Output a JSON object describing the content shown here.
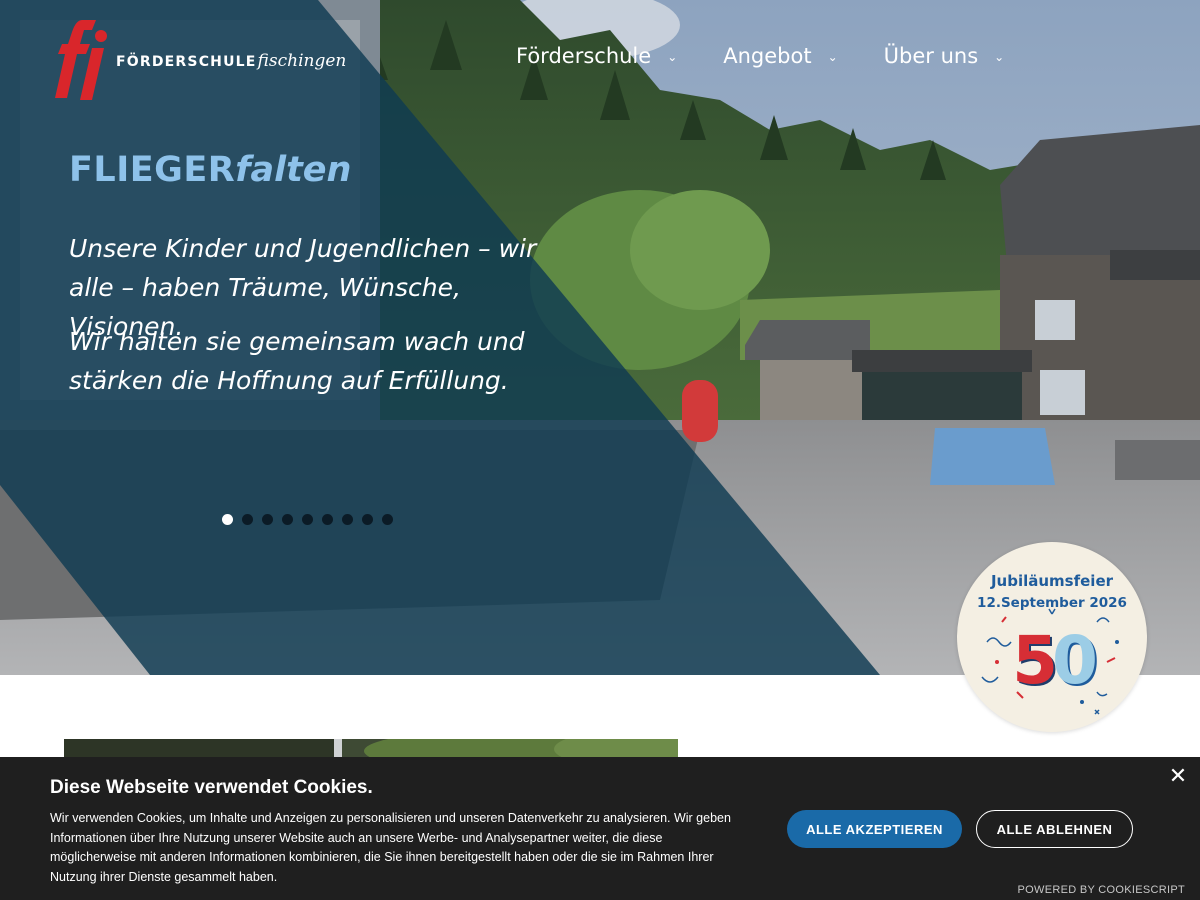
{
  "header": {
    "logo_bold": "FÖRDERSCHULE",
    "logo_italic": "fischingen",
    "nav": [
      {
        "label": "Förderschule",
        "icon": "chevron-down-icon"
      },
      {
        "label": "Angebot",
        "icon": "chevron-down-icon"
      },
      {
        "label": "Über uns",
        "icon": "chevron-down-icon"
      }
    ]
  },
  "slide": {
    "title_bold": "FLIEGER",
    "title_italic": "falten",
    "paragraph_1": "Unsere Kinder und Jugendlichen – wir alle – haben Träume, Wünsche, Visionen.",
    "paragraph_2": "Wir halten sie gemeinsam wach und stärken die Hoffnung auf Erfüllung.",
    "dot_count": 9,
    "active_dot": 1
  },
  "jubilee": {
    "line_1": "Jubiläumsfeier",
    "line_2": "12.September 2026",
    "digit_1": "5",
    "digit_2": "0"
  },
  "cookie": {
    "title": "Diese Webseite verwendet Cookies.",
    "text": "Wir verwenden Cookies, um Inhalte und Anzeigen zu personalisieren und unseren Datenverkehr zu analysieren. Wir geben Informationen über Ihre Nutzung unserer Website auch an unsere Werbe- und Analysepartner weiter, die diese möglicherweise mit anderen Informationen kombinieren, die Sie ihnen bereitgestellt haben oder die sie im Rahmen Ihrer Nutzung ihrer Dienste gesammelt haben.",
    "accept_label": "ALLE AKZEPTIEREN",
    "reject_label": "ALLE ABLEHNEN",
    "close_symbol": "✕",
    "powered_by": "POWERED BY COOKIESCRIPT"
  },
  "colors": {
    "overlay": "#0f3a52",
    "title_accent": "#8ec2ea",
    "logo_red": "#d9262b",
    "accept_button": "#1a6aa8",
    "banner_bg": "#1f1f1f"
  }
}
